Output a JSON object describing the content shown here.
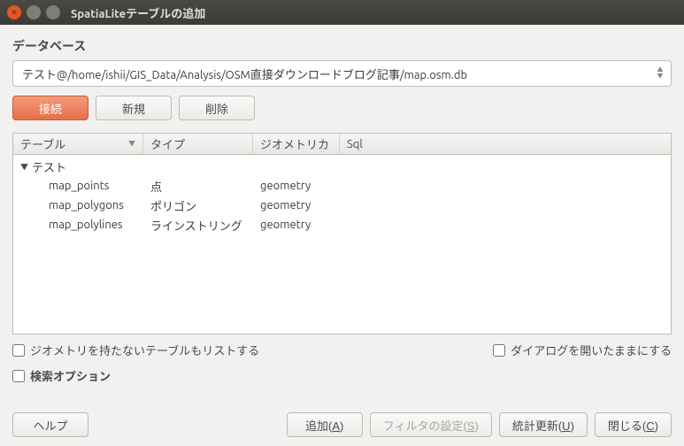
{
  "window": {
    "title": "SpatiaLiteテーブルの追加"
  },
  "db": {
    "label": "データベース",
    "selected": "テスト@/home/ishii/GIS_Data/Analysis/OSM直接ダウンロードブログ記事/map.osm.db"
  },
  "buttons": {
    "connect": "接続",
    "new": "新規",
    "delete": "削除",
    "help": "ヘルプ",
    "add": "追加",
    "add_key": "A",
    "filter": "フィルタの設定",
    "filter_key": "S",
    "stats": "統計更新",
    "stats_key": "U",
    "close": "閉じる",
    "close_key": "C"
  },
  "headers": {
    "table": "テーブル",
    "type": "タイプ",
    "geom": "ジオメトリカ",
    "sql": "Sql"
  },
  "group": "テスト",
  "rows": [
    {
      "name": "map_points",
      "type": "点",
      "geom": "geometry",
      "sql": ""
    },
    {
      "name": "map_polygons",
      "type": "ポリゴン",
      "geom": "geometry",
      "sql": ""
    },
    {
      "name": "map_polylines",
      "type": "ラインストリング",
      "geom": "geometry",
      "sql": ""
    }
  ],
  "checks": {
    "nogeom": "ジオメトリを持たないテーブルもリストする",
    "keepopen": "ダイアログを開いたままにする",
    "searchopt": "検索オプション"
  }
}
